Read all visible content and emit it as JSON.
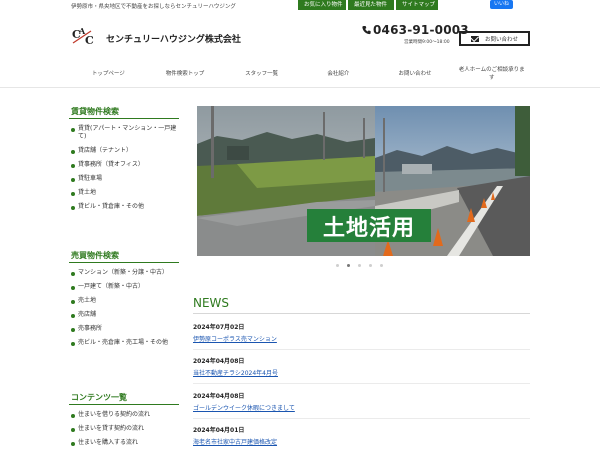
{
  "topbar": {
    "tagline": "伊勢原市・県央地区で不動産をお探しならセンチュリーハウジング",
    "links": [
      "お気に入り物件",
      "最近見た物件",
      "サイトマップ"
    ],
    "like": "いいね"
  },
  "header": {
    "company": "センチュリーハウジング株式会社",
    "phone": "0463-91-0003",
    "hours": "営業時間9:00～18:00",
    "contact": "お問い合わせ"
  },
  "nav": [
    "トップページ",
    "物件検索トップ",
    "スタッフ一覧",
    "会社紹介",
    "お問い合わせ",
    "老人ホームのご相談承ります"
  ],
  "sidebar": {
    "rental": {
      "title": "賃貸物件検索",
      "items": [
        "賃貸(アパート・マンション・一戸建て)",
        "貸店舗（テナント）",
        "貸事務所（貸オフィス）",
        "貸駐車場",
        "貸土地",
        "貸ビル・貸倉庫・その他"
      ]
    },
    "sale": {
      "title": "売買物件検索",
      "items": [
        "マンション（新築・分譲・中古）",
        "一戸建て（新築・中古）",
        "売土地",
        "売店舗",
        "売事務所",
        "売ビル・売倉庫・売工場・その他"
      ]
    },
    "contents": {
      "title": "コンテンツ一覧",
      "items": [
        "住まいを借りる契約の流れ",
        "住まいを貸す契約の流れ",
        "住まいを購入する流れ"
      ]
    }
  },
  "slider": {
    "overlay": "土地活用",
    "dots": 5,
    "active_dot": 1
  },
  "news": {
    "title": "NEWS",
    "items": [
      {
        "date": "2024年07月02日",
        "text": "伊勢原コーポラス売マンション"
      },
      {
        "date": "2024年04月08日",
        "text": "当社不動産チラシ2024年4月号"
      },
      {
        "date": "2024年04月08日",
        "text": "ゴールデンウイーク休暇につきまして"
      },
      {
        "date": "2024年04月01日",
        "text": "海老名市社家中古戸建価格改定"
      }
    ]
  },
  "colors": {
    "brand_green": "#2f7a1f",
    "link_blue": "#1a55b0"
  }
}
